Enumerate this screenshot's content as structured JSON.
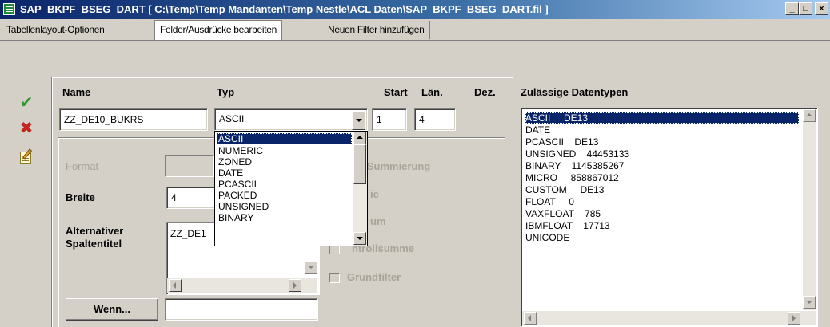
{
  "window": {
    "title": "SAP_BKPF_BSEG_DART [ C:\\Temp\\Temp Mandanten\\Temp Nestle\\ACL Daten\\SAP_BKPF_BSEG_DART.fil ]",
    "min_glyph": "_",
    "max_glyph": "□",
    "close_glyph": "×"
  },
  "tabs": [
    {
      "label": "Tabellenlayout-Optionen"
    },
    {
      "label": "Felder/Ausdrücke bearbeiten"
    },
    {
      "label": "Neuen Filter hinzufügen"
    }
  ],
  "side": {
    "ok_glyph": "✔",
    "cancel_glyph": "✖"
  },
  "form": {
    "name_label": "Name",
    "name_value": "ZZ_DE10_BUKRS",
    "type_label": "Typ",
    "type_value": "ASCII",
    "start_label": "Start",
    "start_value": "1",
    "length_label": "Län.",
    "length_value": "4",
    "dez_label": "Dez.",
    "format_label": "Format",
    "width_label": "Breite",
    "width_value": "4",
    "alt_title_label_1": "Alternativer",
    "alt_title_label_2": "Spaltentitel",
    "alt_title_value": "ZZ_DE1",
    "cb_sum_label": "e Summierung",
    "cb_2_label": "ic",
    "cb_3_label": "um",
    "cb_checksum_label": "Kontrollsumme",
    "cb_checksum_visible": "ntrollsumme",
    "cb_basefilter_label": "Grundfilter",
    "if_button_label": "Wenn...",
    "if_value": ""
  },
  "type_dropdown": {
    "items": [
      "ASCII",
      "NUMERIC",
      "ZONED",
      "DATE",
      "PCASCII",
      "PACKED",
      "UNSIGNED",
      "BINARY"
    ],
    "selected": 0
  },
  "allowed_types": {
    "label": "Zulässige Datentypen",
    "items": [
      "ASCII     DE13",
      "DATE",
      "PCASCII    DE13",
      "UNSIGNED    44453133",
      "BINARY    1145385267",
      "MICRO     858867012",
      "CUSTOM     DE13",
      "FLOAT     0",
      "VAXFLOAT    785",
      "IBMFLOAT    17713",
      "UNICODE"
    ],
    "selected": 0
  },
  "colors": {
    "window_bg": "#d4d0c8",
    "selection": "#0a246a",
    "title_gradient_start": "#0a246a",
    "disabled_text": "#a8a497",
    "ok_green": "#2e9a2e",
    "cancel_red": "#c2261d"
  }
}
